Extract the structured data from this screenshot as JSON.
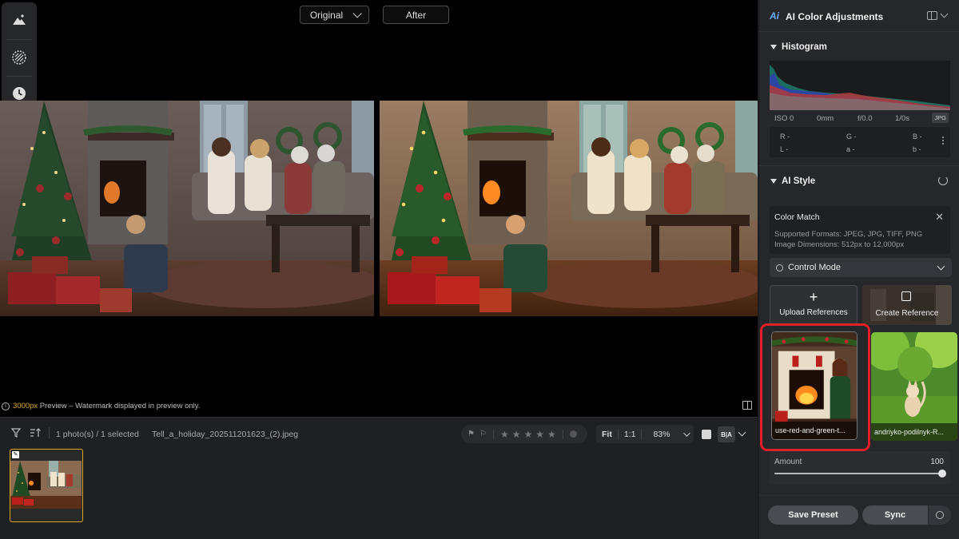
{
  "viewer": {
    "original_label": "Original",
    "after_label": "After",
    "preview_px": "3000px",
    "preview_note": " Preview – Watermark displayed in preview only."
  },
  "filmstrip": {
    "selection": "1 photo(s) / 1 selected",
    "filename": "Tell_a_holiday_202511201623_(2).jpeg",
    "zoom_fit": "Fit",
    "zoom_1to1": "1:1",
    "zoom_level": "83%",
    "rating": 0,
    "ba_label": "B|A"
  },
  "panel": {
    "title": "AI Color Adjustments",
    "logo": "Ai",
    "histogram_title": "Histogram",
    "exif": {
      "iso": "ISO 0",
      "focal": "0mm",
      "aperture": "f/0.0",
      "shutter": "1/0s",
      "format": "JPG"
    },
    "readout": {
      "r": "R -",
      "g": "G -",
      "b": "B -",
      "l": "L -",
      "a": "a -",
      "b2": "b -"
    },
    "ai_style_title": "AI Style",
    "color_match": {
      "title": "Color Match",
      "formats": "Supported Formats: JPEG, JPG, TIFF, PNG",
      "dimensions": "Image Dimensions: 512px to 12,000px"
    },
    "control_mode": "Control Mode",
    "upload_label": "Upload References",
    "create_label": "Create Reference",
    "references": [
      {
        "label": "use-red-and-green-t..."
      },
      {
        "label": "andriyko-podilnyk-R..."
      }
    ],
    "amount_label": "Amount",
    "amount_value": "100",
    "amount_fraction": 1.0,
    "save_preset": "Save Preset",
    "sync": "Sync"
  },
  "colors": {
    "accent_yellow": "#d9a520",
    "highlight_red": "#e01f2b",
    "panel_bg": "#26272a"
  }
}
